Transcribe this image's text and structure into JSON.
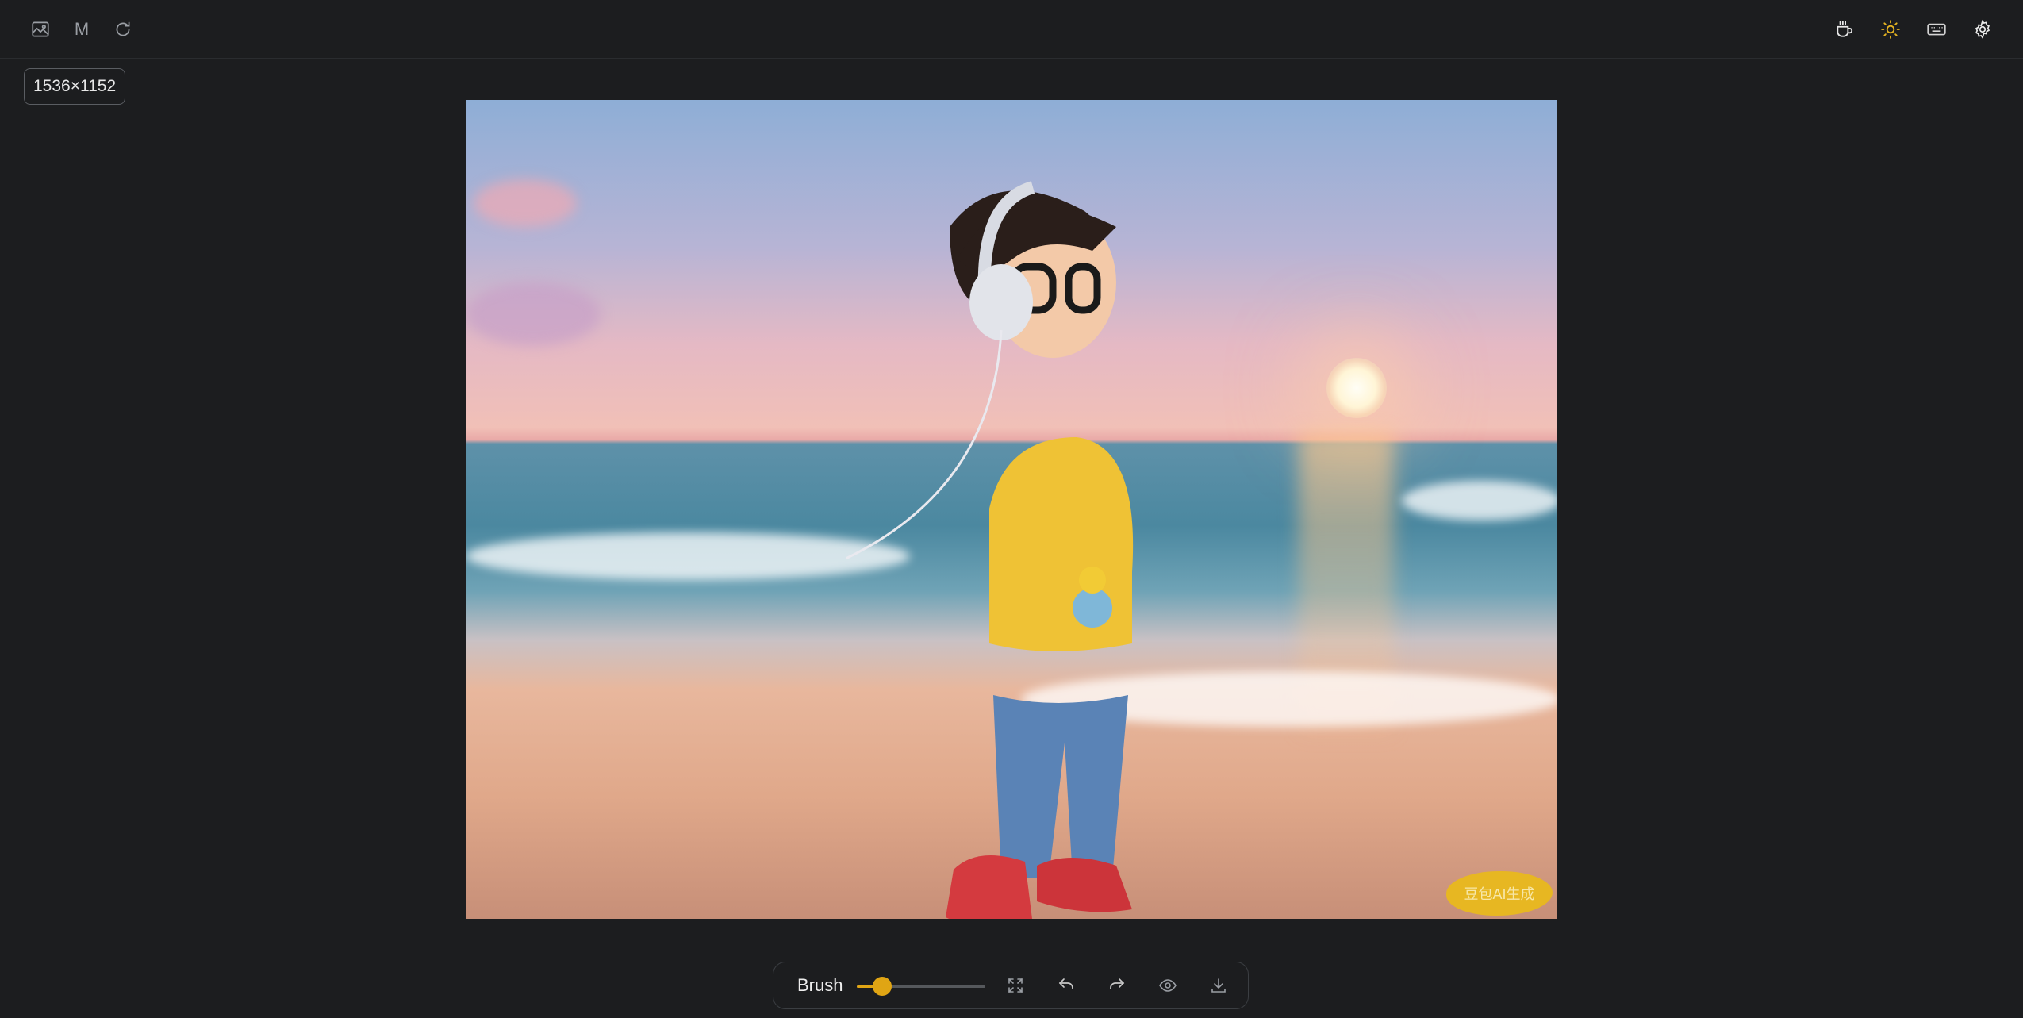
{
  "header": {
    "left_icons": [
      "image-icon",
      "m-text-icon",
      "refresh-icon"
    ],
    "m_label": "M",
    "right_icons": [
      "coffee-icon",
      "sun-icon",
      "keyboard-icon",
      "gear-icon"
    ]
  },
  "image": {
    "dimensions_label": "1536×1152",
    "description_alt": "",
    "watermark_text": "豆包AI生成"
  },
  "toolbar": {
    "tool_label": "Brush",
    "brush_size": 0.2,
    "icons": [
      "expand-icon",
      "undo-icon",
      "redo-icon",
      "eye-icon",
      "download-icon"
    ]
  },
  "colors": {
    "background": "#1c1d1f",
    "accent": "#e0a514",
    "sun_icon": "#e6b422",
    "icon_muted": "#9a9ea4"
  }
}
